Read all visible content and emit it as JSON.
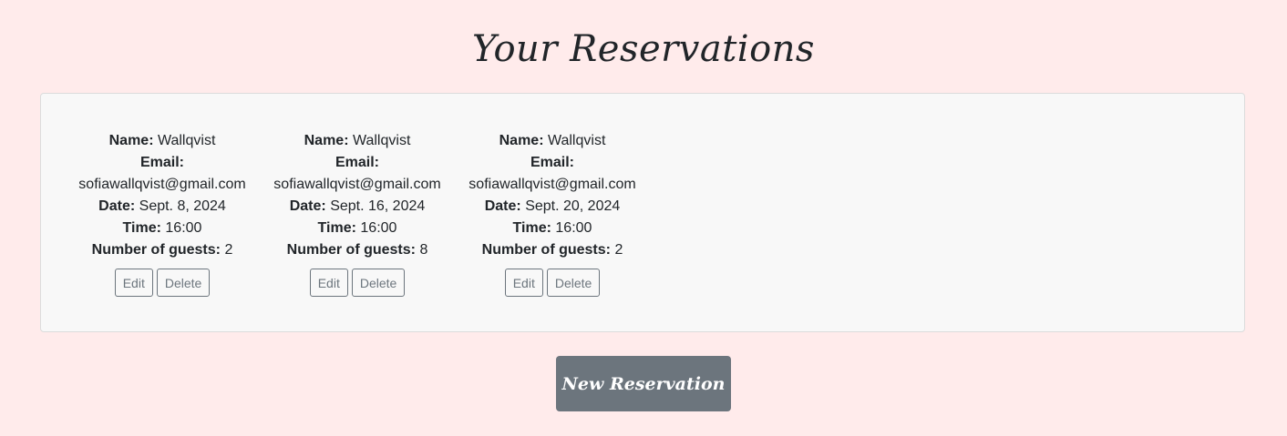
{
  "page": {
    "title": "Your Reservations"
  },
  "labels": {
    "name": "Name:",
    "email": "Email:",
    "date": "Date:",
    "time": "Time:",
    "guests": "Number of guests:"
  },
  "reservations": [
    {
      "name": "Wallqvist",
      "email": "sofiawallqvist@gmail.com",
      "date": "Sept. 8, 2024",
      "time": "16:00",
      "guests": "2",
      "edit_label": "Edit",
      "delete_label": "Delete"
    },
    {
      "name": "Wallqvist",
      "email": "sofiawallqvist@gmail.com",
      "date": "Sept. 16, 2024",
      "time": "16:00",
      "guests": "8",
      "edit_label": "Edit",
      "delete_label": "Delete"
    },
    {
      "name": "Wallqvist",
      "email": "sofiawallqvist@gmail.com",
      "date": "Sept. 20, 2024",
      "time": "16:00",
      "guests": "2",
      "edit_label": "Edit",
      "delete_label": "Delete"
    }
  ],
  "actions": {
    "new_reservation_label": "New Reservation"
  },
  "colors": {
    "background": "#ffebeb",
    "panel": "#f8f8f8",
    "secondary": "#6c757d"
  }
}
